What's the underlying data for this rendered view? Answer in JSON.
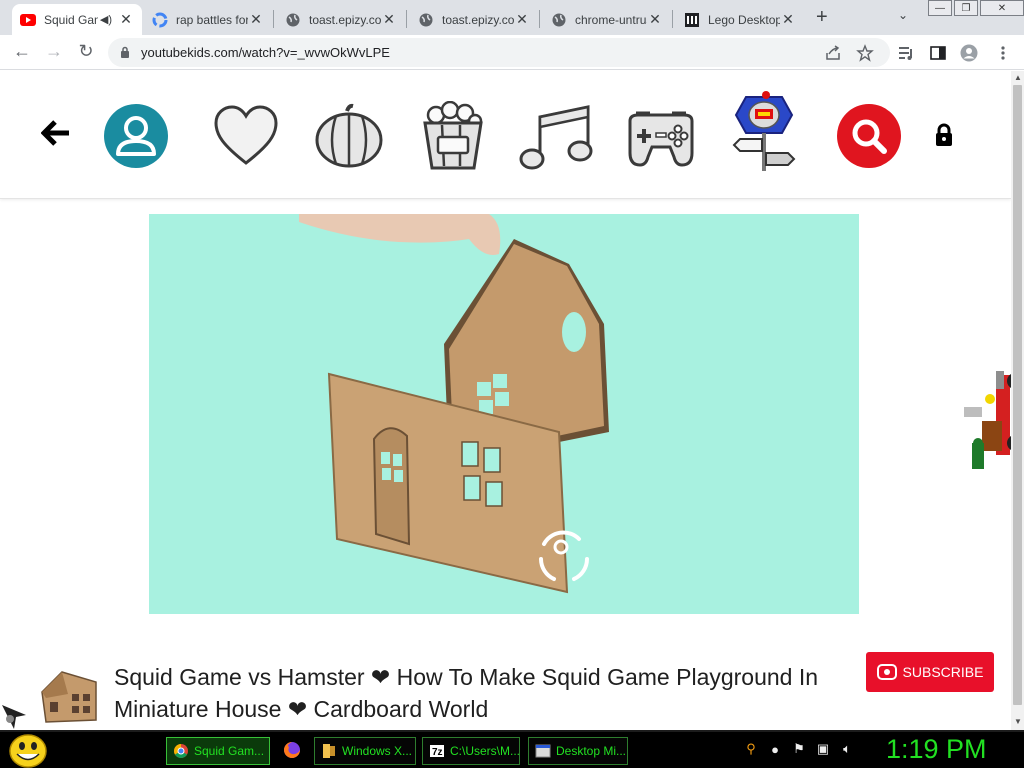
{
  "browser": {
    "tabs": [
      {
        "title": "Squid Game vs Hamster",
        "favicon": "youtube-icon",
        "audio": true
      },
      {
        "title": "rap battles for kids",
        "favicon": "google-icon"
      },
      {
        "title": "toast.epizy.com",
        "favicon": "globe-icon"
      },
      {
        "title": "toast.epizy.com",
        "favicon": "globe-icon"
      },
      {
        "title": "chrome-untrusted",
        "favicon": "globe-icon"
      },
      {
        "title": "Lego Desktop",
        "favicon": "museum-icon"
      }
    ],
    "url": "youtubekids.com/watch?v=_wvwOkWvLPE",
    "colors": {
      "tabstrip": "#dee1e6",
      "omnibox": "#f1f3f4"
    }
  },
  "kidsnav": {
    "items": [
      "back-arrow-icon",
      "profile-icon",
      "heart-icon",
      "pumpkin-icon",
      "popcorn-icon",
      "music-note-icon",
      "game-controller-icon",
      "lego-sign-icon",
      "search-icon",
      "lock-icon"
    ],
    "colors": {
      "profile": "#1a8ca0",
      "search": "#e0151f"
    }
  },
  "video": {
    "background": "#a8f1e0",
    "title": "Squid Game vs Hamster ❤ How To Make Squid Game Playground In Miniature House ❤ Cardboard World",
    "subscribe_label": "SUBSCRIBE",
    "subscribe_color": "#e8102a"
  },
  "taskbar": {
    "tasks": [
      {
        "label": "Squid Gam...",
        "icon": "chrome-icon",
        "active": true
      },
      {
        "label": "Windows X...",
        "icon": "folder-icon"
      },
      {
        "label": "C:\\Users\\M...",
        "icon": "7zip-icon"
      },
      {
        "label": "Desktop Mi...",
        "icon": "window-icon"
      }
    ],
    "clock": "1:19 PM",
    "accent": "#22e022"
  }
}
